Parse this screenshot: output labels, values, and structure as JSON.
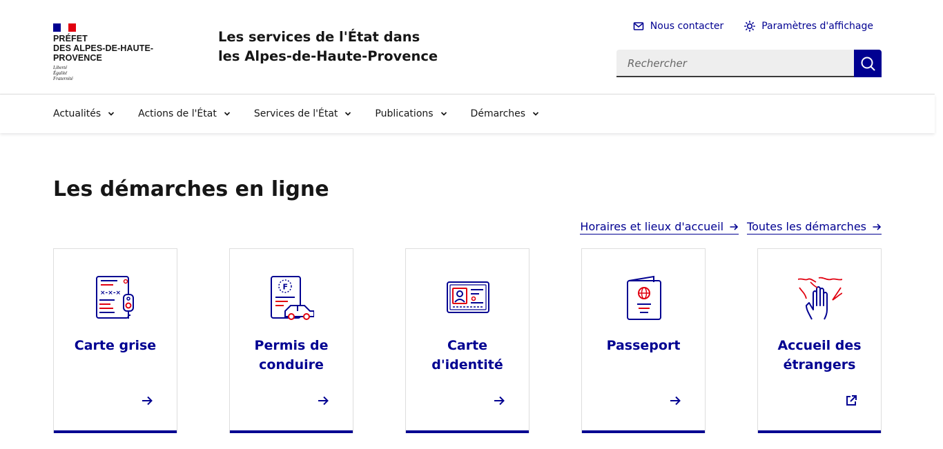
{
  "header": {
    "logo": {
      "line1": "Préfet",
      "line2": "des Alpes-de-Haute-Provence",
      "devise": [
        "Liberté",
        "Égalité",
        "Fraternité"
      ]
    },
    "service_title": "Les services de l'État dans les Alpes-de-Haute-Provence",
    "tools": {
      "contact": "Nous contacter",
      "display": "Paramètres d'affichage"
    },
    "search": {
      "placeholder": "Rechercher",
      "button_icon": "search-icon"
    }
  },
  "nav": {
    "items": [
      "Actualités",
      "Actions de l'État",
      "Services de l'État",
      "Publications",
      "Démarches"
    ]
  },
  "main": {
    "title": "Les démarches en ligne",
    "links": {
      "horaires": "Horaires et lieux d'accueil",
      "toutes": "Toutes les démarches"
    },
    "cards": [
      {
        "title": "Carte grise",
        "icon": "vehicle-registration-icon",
        "arrow": "arrow-right-icon"
      },
      {
        "title": "Permis de conduire",
        "icon": "driving-license-icon",
        "arrow": "arrow-right-icon"
      },
      {
        "title": "Carte d'identité",
        "icon": "id-card-icon",
        "arrow": "arrow-right-icon"
      },
      {
        "title": "Passeport",
        "icon": "passport-icon",
        "arrow": "arrow-right-icon"
      },
      {
        "title": "Accueil des étrangers",
        "icon": "welcome-hand-icon",
        "arrow": "external-link-icon"
      }
    ]
  },
  "colors": {
    "primary": "#000091",
    "accent_red": "#e1000f",
    "text": "#161616",
    "border": "#dddddd",
    "input_bg": "#eeeeee"
  }
}
